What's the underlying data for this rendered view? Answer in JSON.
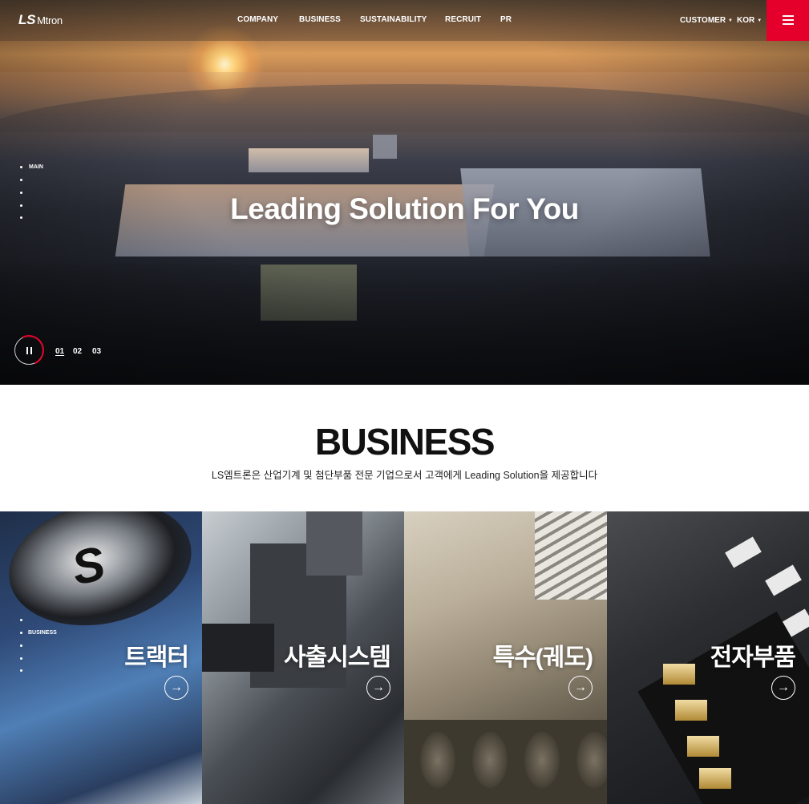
{
  "header": {
    "logo_mark": "LS",
    "logo_text": "Mtron",
    "nav": [
      "COMPANY",
      "BUSINESS",
      "SUSTAINABILITY",
      "RECRUIT",
      "PR"
    ],
    "customer_label": "CUSTOMER",
    "language_label": "KOR",
    "accent_color": "#e4002b"
  },
  "hero": {
    "side_nav_label": "MAIN",
    "title": "Leading Solution For You",
    "slides": [
      "01",
      "02",
      "03"
    ],
    "active_slide": "01"
  },
  "business": {
    "title": "BUSINESS",
    "description": "LS엠트론은 산업기계 및 첨단부품 전문 기업으로서 고객에게 Leading Solution을 제공합니다",
    "side_nav_label": "BUSINESS",
    "cards": [
      {
        "name": "트랙터"
      },
      {
        "name": "사출시스템"
      },
      {
        "name": "특수(궤도)"
      },
      {
        "name": "전자부품"
      }
    ]
  }
}
